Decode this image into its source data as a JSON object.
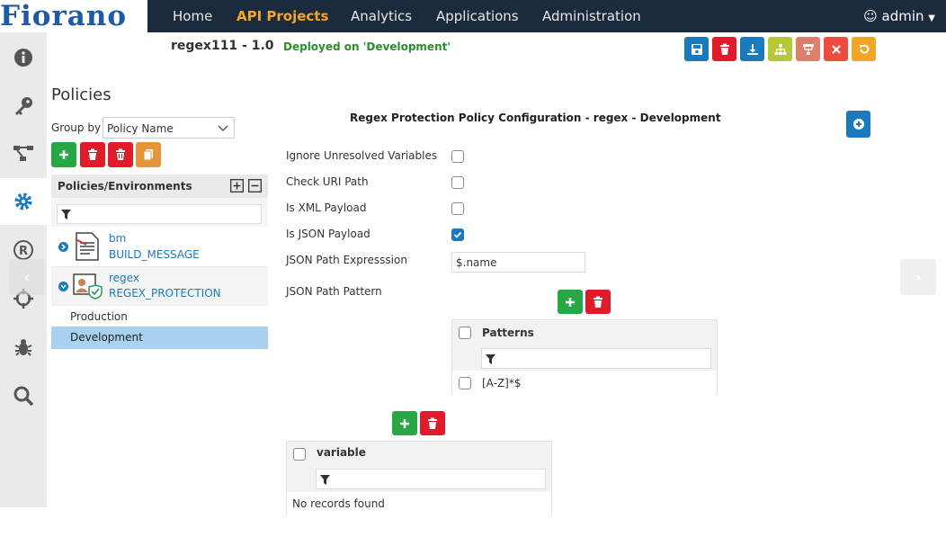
{
  "app": {
    "logo": "Fiorano",
    "nav": [
      "Home",
      "API Projects",
      "Analytics",
      "Applications",
      "Administration"
    ],
    "active_nav": "API Projects",
    "user": "admin"
  },
  "project": {
    "name": "regex111 - 1.0",
    "status": "Deployed on 'Development'"
  },
  "policies": {
    "title": "Policies",
    "group_by_label": "Group by",
    "group_by_value": "Policy Name",
    "tree_header": "Policies/Environments",
    "items": [
      {
        "name": "bm",
        "type": "BUILD_MESSAGE"
      },
      {
        "name": "regex",
        "type": "REGEX_PROTECTION"
      }
    ],
    "environments": [
      "Production",
      "Development"
    ],
    "selected_env": "Development"
  },
  "config": {
    "title": "Regex Protection Policy Configuration - regex - Development",
    "fields": [
      {
        "label": "Ignore Unresolved Variables",
        "checked": false
      },
      {
        "label": "Check URI Path",
        "checked": false
      },
      {
        "label": "Is XML Payload",
        "checked": false
      },
      {
        "label": "Is JSON Payload",
        "checked": true
      }
    ],
    "json_path_expression_label": "JSON Path Expresssion",
    "json_path_expression_value": "$.name",
    "json_path_pattern_label": "JSON Path Pattern",
    "patterns_header": "Patterns",
    "patterns": [
      "[A-Z]*$"
    ],
    "variable_header": "variable",
    "no_records": "No records found"
  },
  "colors": {
    "nav_bg": "#1c2a3d",
    "accent": "#f5a623",
    "primary": "#1a7ac0",
    "add": "#27a844",
    "delete": "#e21b2a",
    "selected_row": "#a8d2f0",
    "status_green": "#2a8f2a"
  }
}
